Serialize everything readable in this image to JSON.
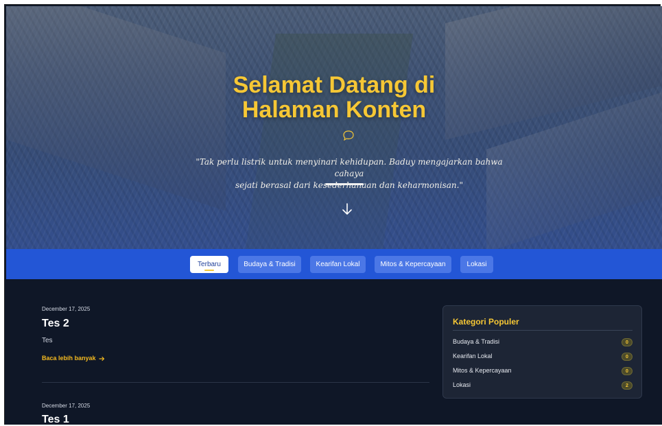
{
  "hero": {
    "title_line1": "Selamat Datang di",
    "title_line2": "Halaman Konten",
    "quote_line1": "\"Tak perlu listrik untuk menyinari kehidupan. Baduy mengajarkan bahwa cahaya",
    "quote_line2": "sejati berasal dari kesederhanaan dan keharmonisan.\"",
    "title_color": "#f6c735"
  },
  "tabs": [
    {
      "label": "Terbaru",
      "active": true
    },
    {
      "label": "Budaya & Tradisi",
      "active": false
    },
    {
      "label": "Kearifan Lokal",
      "active": false
    },
    {
      "label": "Mitos & Kepercayaan",
      "active": false
    },
    {
      "label": "Lokasi",
      "active": false
    }
  ],
  "tabs_bar_color": "#2356d6",
  "posts": [
    {
      "date": "December 17, 2025",
      "title": "Tes 2",
      "excerpt": "Tes",
      "read_more": "Baca lebih banyak"
    },
    {
      "date": "December 17, 2025",
      "title": "Tes 1"
    }
  ],
  "sidebar": {
    "title": "Kategori Populer",
    "categories": [
      {
        "label": "Budaya & Tradisi",
        "count": "0"
      },
      {
        "label": "Kearifan Lokal",
        "count": "0"
      },
      {
        "label": "Mitos & Kepercayaan",
        "count": "0"
      },
      {
        "label": "Lokasi",
        "count": "2"
      }
    ]
  },
  "icons": {
    "chat": "chat-bubble-icon",
    "scroll": "arrow-down-icon",
    "read_more": "arrow-right-icon"
  }
}
